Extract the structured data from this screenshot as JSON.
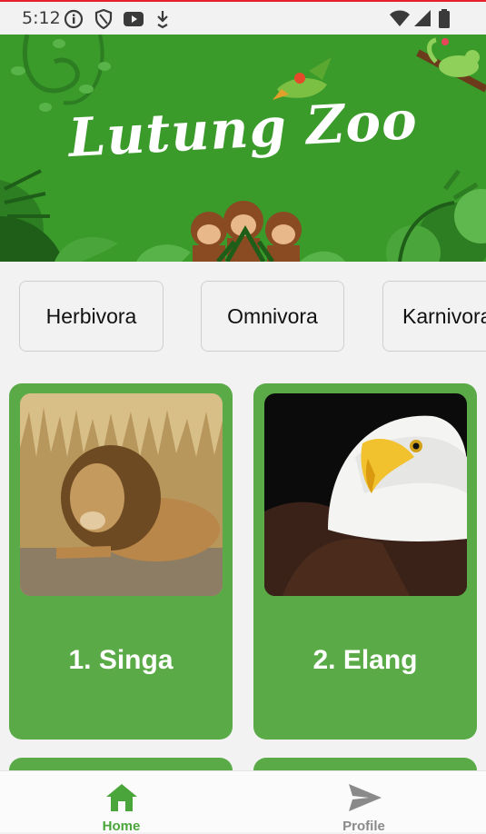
{
  "status_bar": {
    "time": "5:12",
    "icons": [
      "info-icon",
      "shield-icon",
      "youtube-icon",
      "download-icon",
      "wifi-icon",
      "signal-icon",
      "battery-icon"
    ]
  },
  "banner": {
    "title": "Lutung Zoo",
    "background_color": "#3a9a2a"
  },
  "categories": [
    {
      "label": "Herbivora"
    },
    {
      "label": "Omnivora"
    },
    {
      "label": "Karnivora"
    }
  ],
  "animals": [
    {
      "label": "1. Singa",
      "image": "lion-photo"
    },
    {
      "label": "2. Elang",
      "image": "eagle-photo"
    }
  ],
  "bottom_nav": {
    "items": [
      {
        "label": "Home",
        "icon": "home-icon",
        "active": true,
        "color": "#4aa63a"
      },
      {
        "label": "Profile",
        "icon": "send-icon",
        "active": false,
        "color": "#8a8a8a"
      }
    ]
  },
  "colors": {
    "card": "#5aab47",
    "accent": "#4aa63a"
  }
}
